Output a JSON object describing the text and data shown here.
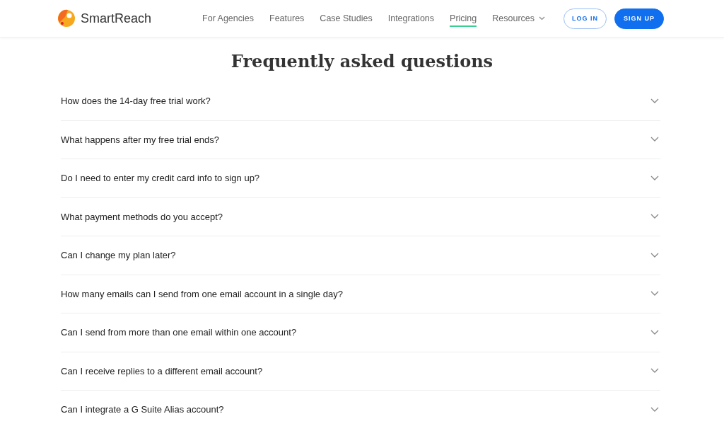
{
  "header": {
    "logo_text": "SmartReach",
    "nav": [
      {
        "label": "For Agencies",
        "selected": false,
        "dropdown": false
      },
      {
        "label": "Features",
        "selected": false,
        "dropdown": false
      },
      {
        "label": "Case Studies",
        "selected": false,
        "dropdown": false
      },
      {
        "label": "Integrations",
        "selected": false,
        "dropdown": false
      },
      {
        "label": "Pricing",
        "selected": true,
        "dropdown": false
      },
      {
        "label": "Resources",
        "selected": false,
        "dropdown": true
      }
    ],
    "login": "LOG IN",
    "signup": "SIGN UP"
  },
  "faq": {
    "title": "Frequently asked questions",
    "items": [
      {
        "question": "How does the 14-day free trial work?",
        "expanded": false
      },
      {
        "question": "What happens after my free trial ends?",
        "expanded": false
      },
      {
        "question": "Do I need to enter my credit card info to sign up?",
        "expanded": false
      },
      {
        "question": "What payment methods do you accept?",
        "expanded": false
      },
      {
        "question": "Can I change my plan later?",
        "expanded": false
      },
      {
        "question": "How many emails can I send from one email account in a single day?",
        "expanded": false
      },
      {
        "question": "Can I send from more than one email within one account?",
        "expanded": false
      },
      {
        "question": "Can I receive replies to a different email account?",
        "expanded": false
      },
      {
        "question": "Can I integrate a G Suite Alias account?",
        "expanded": false
      }
    ]
  }
}
